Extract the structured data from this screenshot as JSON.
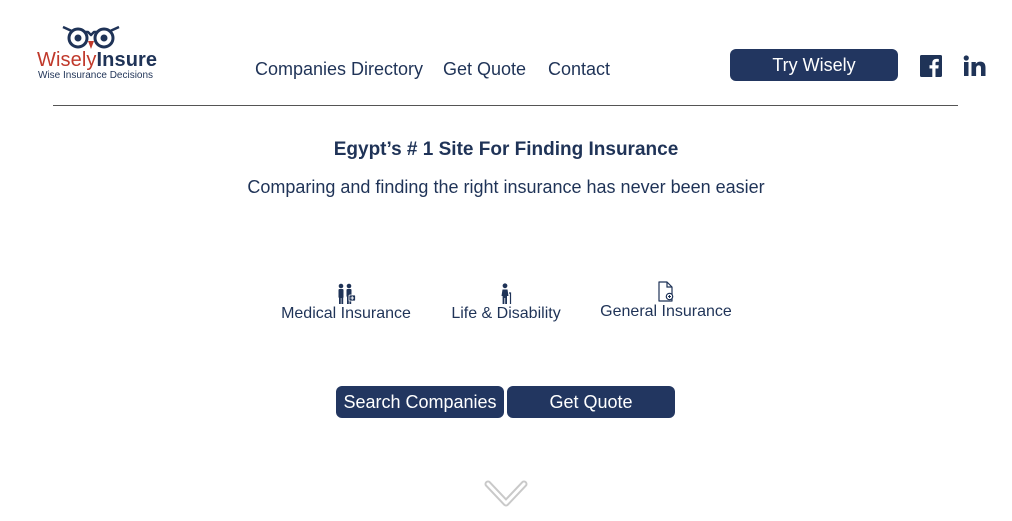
{
  "brand": {
    "name_part1": "Wisely",
    "name_part2": "Insure",
    "tagline": "Wise Insurance Decisions",
    "logo_icon": "owl-glasses-icon"
  },
  "nav": {
    "links": [
      {
        "label": "Companies Directory"
      },
      {
        "label": "Get Quote"
      },
      {
        "label": "Contact"
      }
    ],
    "cta_label": "Try Wisely",
    "social": [
      {
        "icon": "facebook-icon"
      },
      {
        "icon": "linkedin-icon"
      }
    ]
  },
  "hero": {
    "headline": "Egypt’s # 1 Site For Finding Insurance",
    "subheadline": "Comparing and finding the right insurance has never been easier"
  },
  "categories": [
    {
      "label": "Medical Insurance",
      "icon": "family-medical-icon"
    },
    {
      "label": "Life & Disability",
      "icon": "person-cane-icon"
    },
    {
      "label": "General Insurance",
      "icon": "document-icon"
    }
  ],
  "actions": {
    "primary_label": "Search Companies",
    "secondary_label": "Get Quote"
  },
  "scroll_icon": "chevron-down-icon",
  "colors": {
    "brand_navy": "#223660",
    "brand_red": "#c0392b",
    "text": "#1f3357"
  }
}
